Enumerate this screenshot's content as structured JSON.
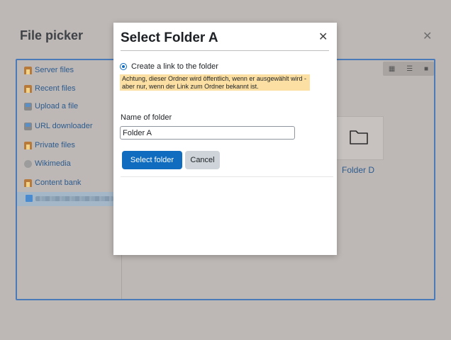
{
  "picker": {
    "title": "File picker",
    "close_glyph": "✕",
    "repositories": [
      {
        "label": "Server files",
        "icon": "repository-icon"
      },
      {
        "label": "Recent files",
        "icon": "repository-icon"
      },
      {
        "label": "Upload a file",
        "icon": "upload-icon"
      },
      {
        "label": "URL downloader",
        "icon": "upload-icon"
      },
      {
        "label": "Private files",
        "icon": "repository-icon"
      },
      {
        "label": "Wikimedia",
        "icon": "globe-icon"
      },
      {
        "label": "Content bank",
        "icon": "repository-icon"
      }
    ],
    "view_icons": [
      "grid-view-icon",
      "list-view-icon",
      "folder-view-icon"
    ],
    "folder_item": {
      "label": "Folder D"
    }
  },
  "dialog": {
    "title": "Select Folder A",
    "close_glyph": "✕",
    "radio_label": "Create a link to the folder",
    "warning": "Achtung, dieser Ordner wird öffentlich, wenn er ausgewählt wird - aber nur, wenn der Link zum Ordner bekannt ist.",
    "name_label": "Name of folder",
    "name_value": "Folder A",
    "select_button": "Select folder",
    "cancel_button": "Cancel"
  },
  "colors": {
    "primary": "#0f6cbf",
    "warning_bg": "#fcdfa2",
    "overlay": "#bdb7b5"
  }
}
